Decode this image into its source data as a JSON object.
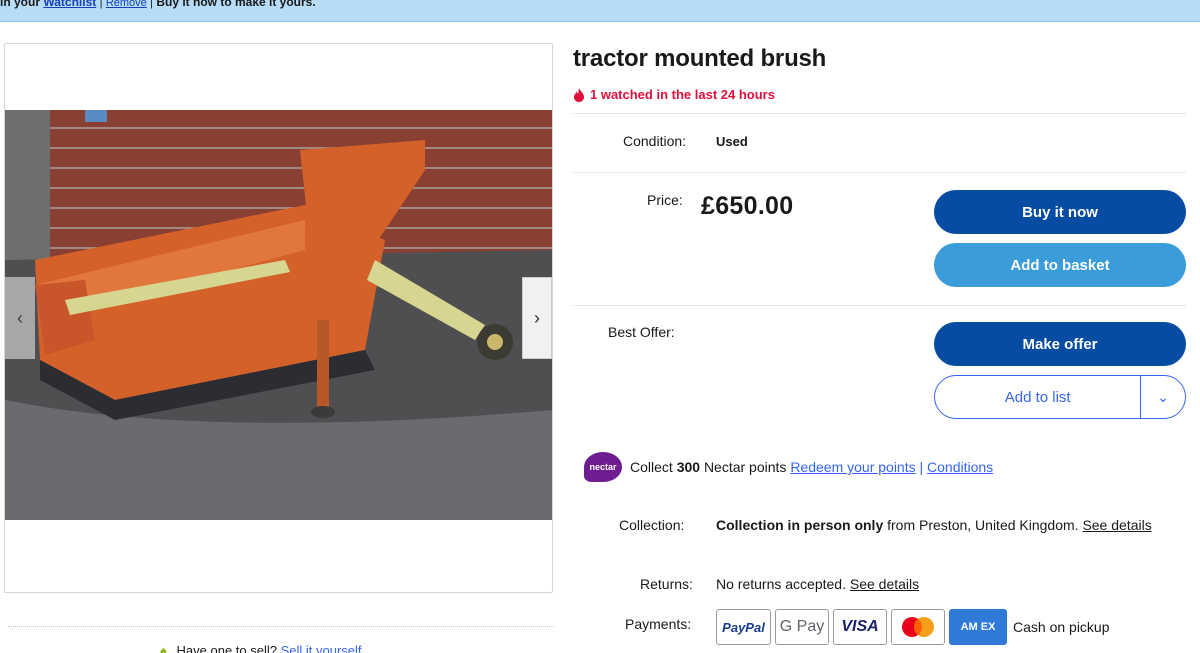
{
  "banner": {
    "prefix": "in your",
    "watchlist_link": "Watchlist",
    "sep1": "|",
    "remove_link": "Remove",
    "sep2": "|",
    "message": "Buy it now to make it yours."
  },
  "item": {
    "title": "tractor mounted brush",
    "watched": "1 watched in the last 24 hours",
    "condition_label": "Condition:",
    "condition_value": "Used",
    "price_label": "Price:",
    "price_value": "£650.00",
    "best_offer_label": "Best Offer:"
  },
  "actions": {
    "buy_now": "Buy it now",
    "add_to_basket": "Add to basket",
    "make_offer": "Make offer",
    "add_to_list": "Add to list"
  },
  "nectar": {
    "logo_text": "nectar",
    "collect_prefix": "Collect",
    "points": "300",
    "collect_suffix": "Nectar points",
    "redeem_link": "Redeem your points",
    "sep": "|",
    "conditions_link": "Conditions"
  },
  "details": {
    "collection_label": "Collection:",
    "collection_bold": "Collection in person only",
    "collection_rest": "from Preston, United Kingdom.",
    "collection_link": "See details",
    "returns_label": "Returns:",
    "returns_value": "No returns accepted.",
    "returns_link": "See details",
    "payments_label": "Payments:",
    "payment_methods": [
      "PayPal",
      "G Pay",
      "VISA",
      "Mastercard",
      "AMEX",
      "Cash on pickup"
    ],
    "paypal": "PayPal",
    "gpay": "G Pay",
    "visa": "VISA",
    "amex": "AM EX",
    "cash": "Cash on pickup"
  },
  "sell": {
    "prompt": "Have one to sell?",
    "link": "Sell it yourself"
  },
  "icons": [
    "flame-icon",
    "chevron-left-icon",
    "chevron-right-icon",
    "chevron-down-icon",
    "leaf-icon",
    "nectar-logo"
  ],
  "colors": {
    "primary_button": "#064ca3",
    "secondary_button": "#3a9cd8",
    "link": "#3665f3",
    "alert": "#e0103a",
    "banner": "#b6dcf7"
  }
}
